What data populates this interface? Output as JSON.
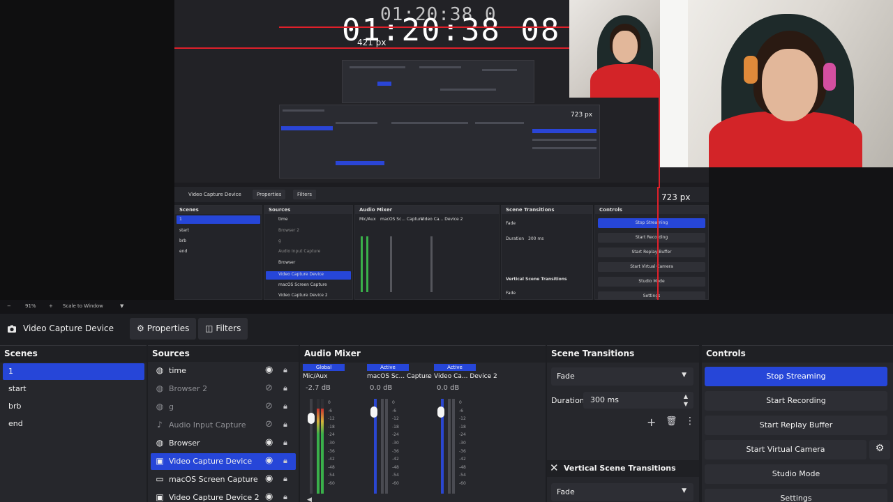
{
  "preview": {
    "timer": "01:20:38 08",
    "timer_echo": "01:20:38 0",
    "measure_top": "723 px",
    "measure_right": "723 px",
    "measure_inner": "421 px",
    "mini": {
      "source_title": "Video Capture Device",
      "properties": "Properties",
      "filters": "Filters",
      "scenes_title": "Scenes",
      "sources_title": "Sources",
      "mixer_title": "Audio Mixer",
      "transitions_title": "Scene Transitions",
      "controls_title": "Controls",
      "scenes": [
        "1",
        "start",
        "brb",
        "end"
      ],
      "sources": [
        "time",
        "Browser 2",
        "g",
        "Audio Input Capture",
        "Browser",
        "Video Capture Device",
        "macOS Screen Capture",
        "Video Capture Device 2"
      ],
      "transition": "Fade",
      "duration_label": "Duration",
      "duration_value": "300 ms",
      "vertical_title": "Vertical Scene Transitions",
      "vertical_transition": "Fade",
      "controls": [
        "Stop Streaming",
        "Start Recording",
        "Start Replay Buffer",
        "Start Virtual Camera",
        "Studio Mode",
        "Settings"
      ],
      "mixer_channels": [
        "Mic/Aux",
        "macOS Sc... Capture",
        "Video Ca... Device 2"
      ]
    }
  },
  "zoombar": {
    "minus": "−",
    "zoom": "91%",
    "plus": "+",
    "scale_mode": "Scale to Window",
    "caret": "▼"
  },
  "context": {
    "source_name": "Video Capture Device",
    "properties_label": "Properties",
    "filters_label": "Filters"
  },
  "scenes": {
    "title": "Scenes",
    "items": [
      {
        "label": "1",
        "active": true
      },
      {
        "label": "start",
        "active": false
      },
      {
        "label": "brb",
        "active": false
      },
      {
        "label": "end",
        "active": false
      }
    ]
  },
  "sources": {
    "title": "Sources",
    "items": [
      {
        "label": "time",
        "icon": "globe-icon",
        "visible": true,
        "active": false
      },
      {
        "label": "Browser 2",
        "icon": "globe-icon",
        "visible": false,
        "active": false
      },
      {
        "label": "g",
        "icon": "globe-icon",
        "visible": false,
        "active": false
      },
      {
        "label": "Audio Input Capture",
        "icon": "microphone-icon",
        "visible": false,
        "active": false
      },
      {
        "label": "Browser",
        "icon": "globe-icon",
        "visible": true,
        "active": false
      },
      {
        "label": "Video Capture Device",
        "icon": "camera-icon",
        "visible": true,
        "active": true
      },
      {
        "label": "macOS Screen Capture",
        "icon": "monitor-icon",
        "visible": true,
        "active": false
      },
      {
        "label": "Video Capture Device 2",
        "icon": "camera-icon",
        "visible": true,
        "active": false
      }
    ]
  },
  "mixer": {
    "title": "Audio Mixer",
    "channels": [
      {
        "tag": "Global",
        "name": "Mic/Aux",
        "db": "-2.7 dB",
        "level": 0.9,
        "fader": 0.85,
        "meter_color": "green"
      },
      {
        "tag": "Active",
        "name": "macOS Sc... Capture",
        "db": "0.0 dB",
        "level": 0.0,
        "fader": 0.92,
        "meter_color": "gray"
      },
      {
        "tag": "Active",
        "name": "Video Ca... Device 2",
        "db": "0.0 dB",
        "level": 0.0,
        "fader": 0.92,
        "meter_color": "gray"
      }
    ],
    "scale": [
      "0",
      "-6",
      "-12",
      "-18",
      "-24",
      "-30",
      "-36",
      "-42",
      "-48",
      "-54",
      "-60"
    ]
  },
  "transitions": {
    "title": "Scene Transitions",
    "selected": "Fade",
    "duration_label": "Duration",
    "duration_value": "300 ms",
    "vertical_title": "Vertical Scene Transitions",
    "vertical_selected": "Fade"
  },
  "controls": {
    "title": "Controls",
    "stop_streaming": "Stop Streaming",
    "start_recording": "Start Recording",
    "start_replay": "Start Replay Buffer",
    "start_virtual_camera": "Start Virtual Camera",
    "studio_mode": "Studio Mode",
    "settings": "Settings"
  },
  "colors": {
    "accent": "#2646d8",
    "background": "#1d1e22",
    "dock": "#26272c",
    "measure_line": "#e0202a"
  }
}
